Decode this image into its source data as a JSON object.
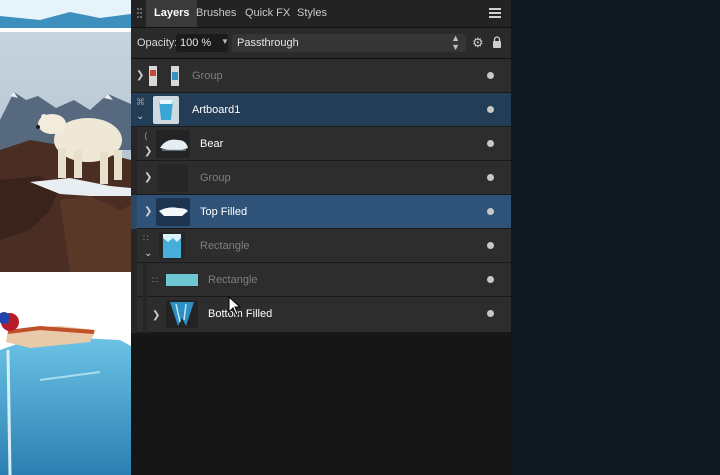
{
  "tabs": [
    {
      "label": "Layers",
      "active": true
    },
    {
      "label": "Brushes",
      "active": false
    },
    {
      "label": "Quick FX",
      "active": false
    },
    {
      "label": "Styles",
      "active": false
    }
  ],
  "toolbar": {
    "opacity_label": "Opacity:",
    "opacity_value": "100 %",
    "blend_mode": "Passthrough"
  },
  "layers": [
    {
      "name": "Group",
      "state": "dim",
      "expanded": false
    },
    {
      "name": "Artboard1",
      "state": "selected-parent",
      "expanded": true
    },
    {
      "name": "Bear",
      "state": "normal",
      "expanded": false
    },
    {
      "name": "Group",
      "state": "dim",
      "expanded": false
    },
    {
      "name": "Top Filled",
      "state": "selected",
      "expanded": false
    },
    {
      "name": "Rectangle",
      "state": "dim",
      "expanded": true
    },
    {
      "name": "Rectangle",
      "state": "dim",
      "expanded": false
    },
    {
      "name": "Bottom Filled",
      "state": "normal",
      "expanded": false
    }
  ],
  "icons": {
    "expand_collapsed": "chevron-right-icon",
    "expand_open": "chevron-down-icon",
    "visibility": "visibility-dot-icon",
    "artboard": "artboard-icon",
    "settings": "gear-icon",
    "lock": "lock-icon",
    "menu": "hamburger-menu-icon"
  },
  "colors": {
    "panel_bg": "#181818",
    "row_bg": "#2d2d2d",
    "selected_row": "#2f5378",
    "selected_parent_row": "#243d56",
    "accent_ice": "#3ab0d8"
  }
}
